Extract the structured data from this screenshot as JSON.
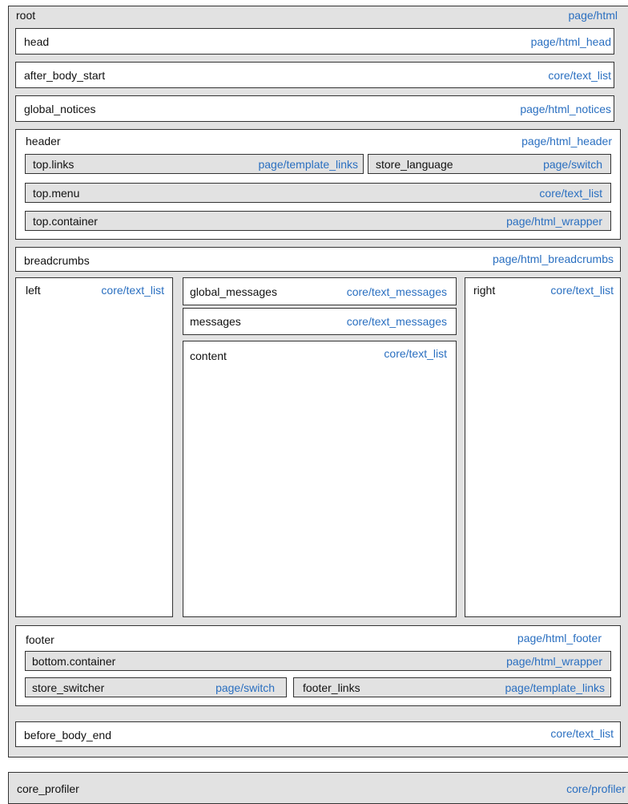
{
  "blocks": {
    "root": {
      "name": "root",
      "type": "page/html"
    },
    "head": {
      "name": "head",
      "type": "page/html_head"
    },
    "after_body_start": {
      "name": "after_body_start",
      "type": "core/text_list"
    },
    "global_notices": {
      "name": "global_notices",
      "type": "page/html_notices"
    },
    "header": {
      "name": "header",
      "type": "page/html_header"
    },
    "top_links": {
      "name": "top.links",
      "type": "page/template_links"
    },
    "store_language": {
      "name": "store_language",
      "type": "page/switch"
    },
    "top_menu": {
      "name": "top.menu",
      "type": "core/text_list"
    },
    "top_container": {
      "name": "top.container",
      "type": "page/html_wrapper"
    },
    "breadcrumbs": {
      "name": "breadcrumbs",
      "type": "page/html_breadcrumbs"
    },
    "left": {
      "name": "left",
      "type": "core/text_list"
    },
    "global_messages": {
      "name": "global_messages",
      "type": "core/text_messages"
    },
    "messages": {
      "name": "messages",
      "type": "core/text_messages"
    },
    "content": {
      "name": "content",
      "type": "core/text_list"
    },
    "right": {
      "name": "right",
      "type": "core/text_list"
    },
    "footer": {
      "name": "footer",
      "type": "page/html_footer"
    },
    "bottom_container": {
      "name": "bottom.container",
      "type": "page/html_wrapper"
    },
    "store_switcher": {
      "name": "store_switcher",
      "type": "page/switch"
    },
    "footer_links": {
      "name": "footer_links",
      "type": "page/template_links"
    },
    "before_body_end": {
      "name": "before_body_end",
      "type": "core/text_list"
    },
    "core_profiler": {
      "name": "core_profiler",
      "type": "core/profiler"
    }
  },
  "colors": {
    "type_text": "#2a6fc0",
    "container_fill": "#e2e2e2",
    "block_fill": "#ffffff",
    "border": "#333333"
  }
}
